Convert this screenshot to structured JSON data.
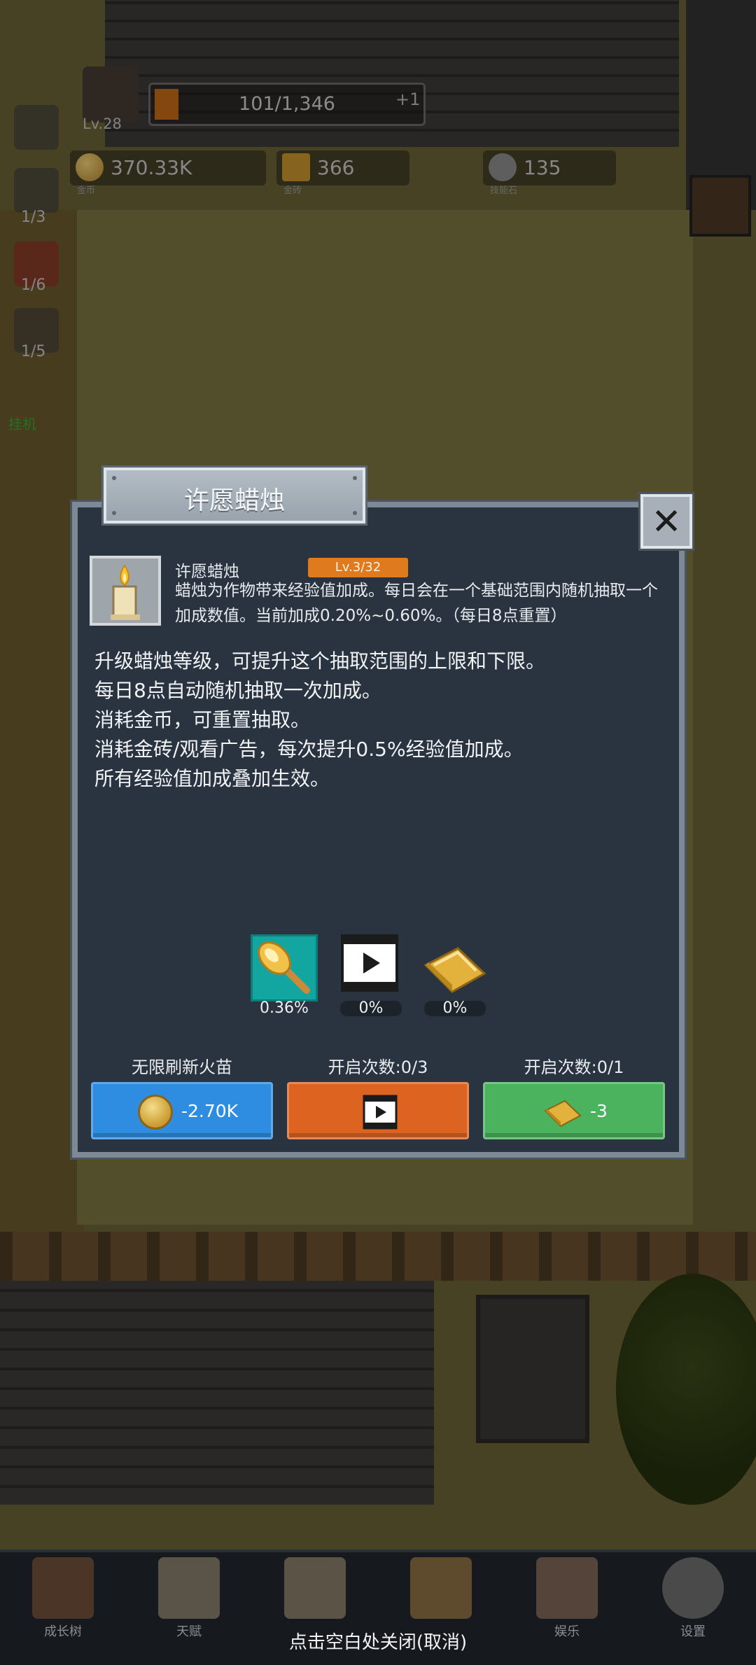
{
  "hud": {
    "exp_text": "101/1,346",
    "exp_fraction": 0.075,
    "plus_text": "+1",
    "level": "Lv.28",
    "resources": [
      {
        "icon": "gold-coin-icon",
        "value": "370.33K",
        "caption": "金币"
      },
      {
        "icon": "gold-brick-icon",
        "value": "366",
        "caption": "金砖"
      },
      {
        "icon": "skill-stone-icon",
        "value": "135",
        "caption": "技能石"
      }
    ],
    "side_counts": [
      "1/3",
      "1/6",
      "1/5"
    ],
    "side_green_label": "挂机"
  },
  "dialog": {
    "title": "许愿蜡烛",
    "item_name": "许愿蜡烛",
    "level_badge": "Lv.3/32",
    "item_desc": "蜡烛为作物带来经验值加成。每日会在一个基础范围内随机抽取一个加成数值。当前加成0.20%~0.60%。（每日8点重置）",
    "rules": [
      "升级蜡烛等级，可提升这个抽取范围的上限和下限。",
      "每日8点自动随机抽取一次加成。",
      "消耗金币，可重置抽取。",
      "消耗金砖/观看广告，每次提升0.5%经验值加成。",
      "所有经验值加成叠加生效。"
    ],
    "bonuses": [
      {
        "icon": "torch-icon",
        "value": "0.36%"
      },
      {
        "icon": "video-play-icon",
        "value": "0%"
      },
      {
        "icon": "gold-brick-icon",
        "value": "0%"
      }
    ],
    "actions": [
      {
        "label": "无限刷新火苗",
        "button_text": "-2.70K",
        "color": "#2f8de1"
      },
      {
        "label": "开启次数:0/3",
        "button_text": "",
        "color": "#dd6320"
      },
      {
        "label": "开启次数:0/1",
        "button_text": "-3",
        "color": "#4bb35e"
      }
    ]
  },
  "bottom_nav": {
    "items": [
      "成长树",
      "天赋",
      "",
      "",
      "娱乐",
      "设置"
    ],
    "close_hint": "点击空白处关闭(取消)"
  }
}
